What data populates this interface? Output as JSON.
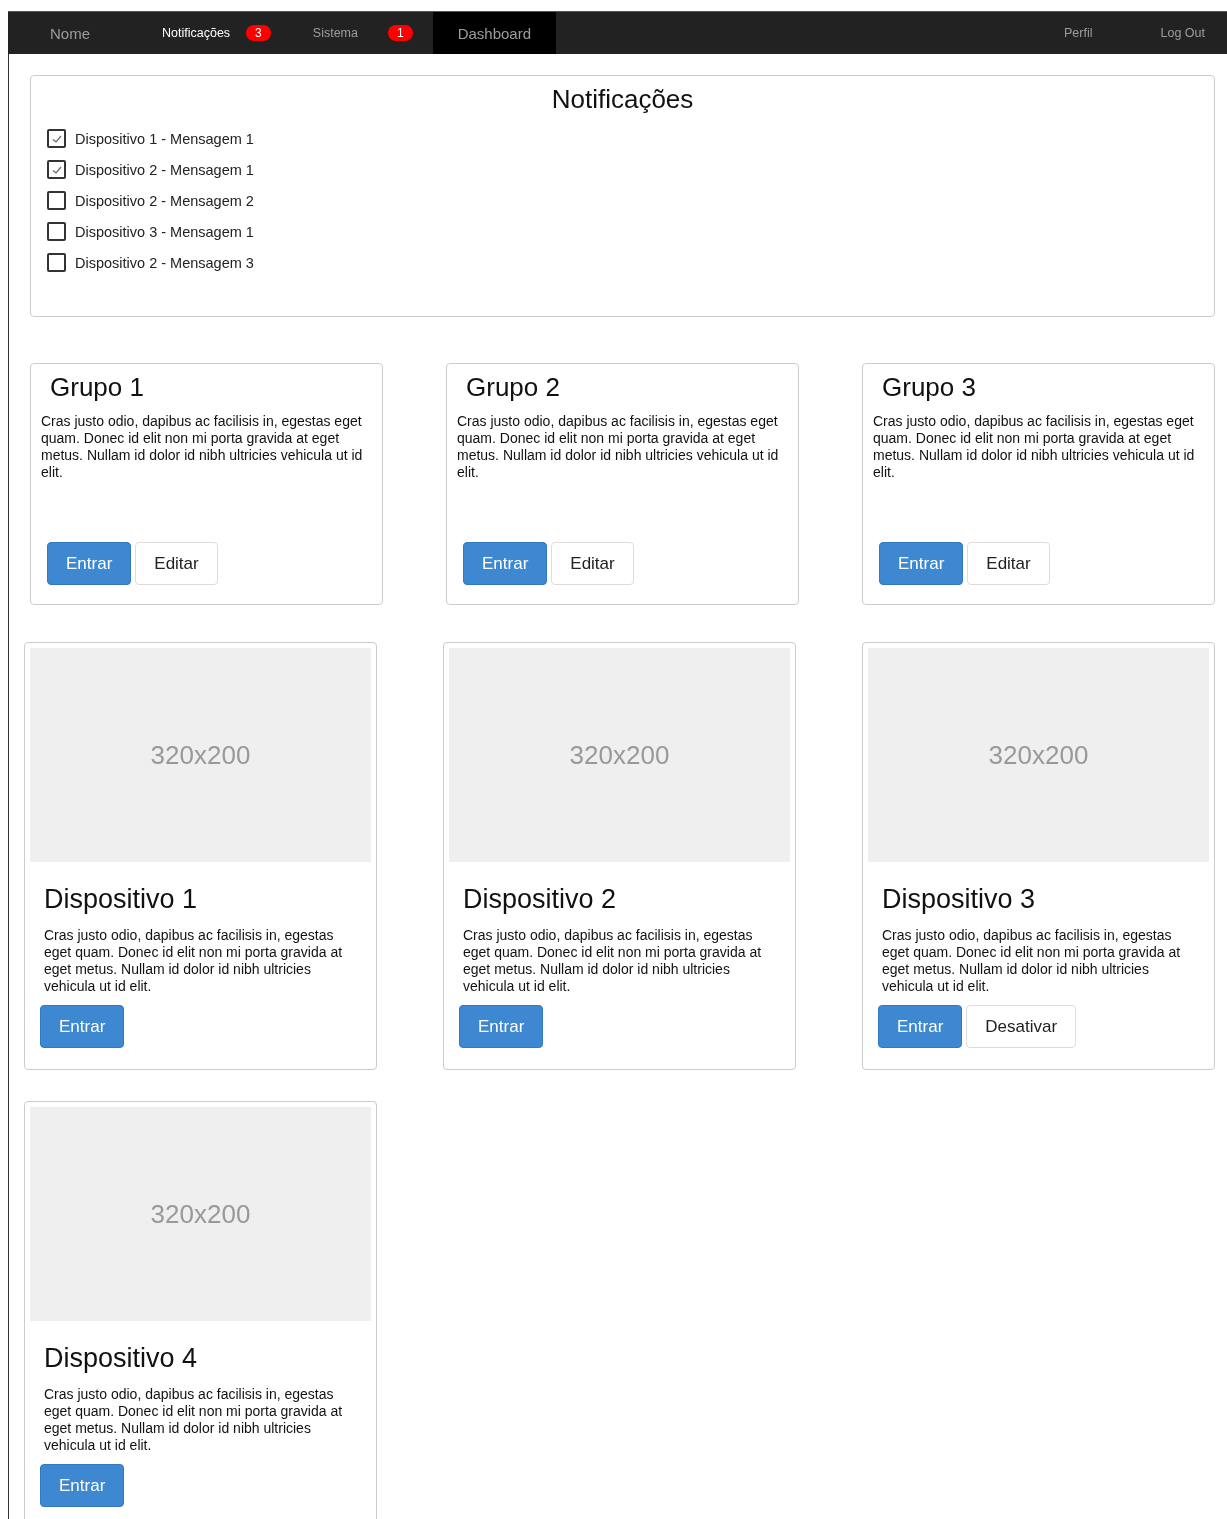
{
  "navbar": {
    "items": [
      {
        "label": "Nome",
        "selected": false,
        "highlighted": false,
        "kind": "brand"
      },
      {
        "label": "Notificações",
        "selected": false,
        "highlighted": true,
        "kind": "link",
        "badge": "3"
      },
      {
        "label": "Sistema",
        "selected": false,
        "highlighted": false,
        "kind": "link",
        "badge": "1"
      },
      {
        "label": "Dashboard",
        "selected": true,
        "highlighted": false,
        "kind": "brand"
      }
    ],
    "right_items": [
      "Perfil",
      "Log Out"
    ]
  },
  "notifications": {
    "title": "Notificações",
    "items": [
      {
        "label": "Dispositivo 1 - Mensagem 1",
        "checked": true
      },
      {
        "label": "Dispositivo 2 - Mensagem 1",
        "checked": true
      },
      {
        "label": "Dispositivo 2 - Mensagem 2",
        "checked": false
      },
      {
        "label": "Dispositivo 3 - Mensagem 1",
        "checked": false
      },
      {
        "label": "Dispositivo 2 - Mensagem 3",
        "checked": false
      }
    ]
  },
  "groups": [
    {
      "title": "Grupo 1",
      "text": "Cras justo odio, dapibus ac facilisis in, egestas eget quam. Donec id elit non mi porta gravida at eget metus. Nullam id dolor id nibh ultricies vehicula ut id elit.",
      "buttons": [
        {
          "label": "Entrar",
          "kind": "primary"
        },
        {
          "label": "Editar",
          "kind": "default"
        }
      ]
    },
    {
      "title": "Grupo 2",
      "text": "Cras justo odio, dapibus ac facilisis in, egestas eget quam. Donec id elit non mi porta gravida at eget metus. Nullam id dolor id nibh ultricies vehicula ut id elit.",
      "buttons": [
        {
          "label": "Entrar",
          "kind": "primary"
        },
        {
          "label": "Editar",
          "kind": "default"
        }
      ]
    },
    {
      "title": "Grupo 3",
      "text": "Cras justo odio, dapibus ac facilisis in, egestas eget quam. Donec id elit non mi porta gravida at eget metus. Nullam id dolor id nibh ultricies vehicula ut id elit.",
      "buttons": [
        {
          "label": "Entrar",
          "kind": "primary"
        },
        {
          "label": "Editar",
          "kind": "default"
        }
      ]
    }
  ],
  "devices": [
    {
      "image_label": "320x200",
      "title": "Dispositivo 1",
      "text": "Cras justo odio, dapibus ac facilisis in, egestas eget quam. Donec id elit non mi porta gravida at eget metus. Nullam id dolor id nibh ultricies vehicula ut id elit.",
      "buttons": [
        {
          "label": "Entrar",
          "kind": "primary"
        }
      ]
    },
    {
      "image_label": "320x200",
      "title": "Dispositivo 2",
      "text": "Cras justo odio, dapibus ac facilisis in, egestas eget quam. Donec id elit non mi porta gravida at eget metus. Nullam id dolor id nibh ultricies vehicula ut id elit.",
      "buttons": [
        {
          "label": "Entrar",
          "kind": "primary"
        }
      ]
    },
    {
      "image_label": "320x200",
      "title": "Dispositivo 3",
      "text": "Cras justo odio, dapibus ac facilisis in, egestas eget quam. Donec id elit non mi porta gravida at eget metus. Nullam id dolor id nibh ultricies vehicula ut id elit.",
      "buttons": [
        {
          "label": "Entrar",
          "kind": "primary"
        },
        {
          "label": "Desativar",
          "kind": "default"
        }
      ]
    },
    {
      "image_label": "320x200",
      "title": "Dispositivo 4",
      "text": "Cras justo odio, dapibus ac facilisis in, egestas eget quam. Donec id elit non mi porta gravida at eget metus. Nullam id dolor id nibh ultricies vehicula ut id elit.",
      "buttons": [
        {
          "label": "Entrar",
          "kind": "primary"
        }
      ]
    }
  ]
}
